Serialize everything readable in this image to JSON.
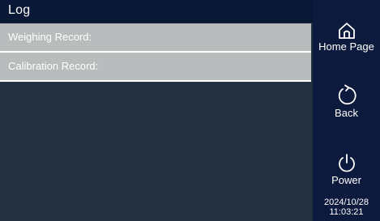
{
  "header": {
    "title": "Log"
  },
  "records": [
    {
      "label": "Weighing Record:"
    },
    {
      "label": "Calibration Record:"
    }
  ],
  "sidebar": {
    "home": {
      "label": "Home Page",
      "icon": "home-icon"
    },
    "back": {
      "label": "Back",
      "icon": "refresh-back-icon"
    },
    "power": {
      "label": "Power",
      "icon": "power-icon"
    },
    "date": "2024/10/28",
    "time": "11:03:21"
  },
  "colors": {
    "background": "#0c1a3e",
    "panel": "#243140",
    "row": "#b9bcbd",
    "text": "#ffffff"
  }
}
